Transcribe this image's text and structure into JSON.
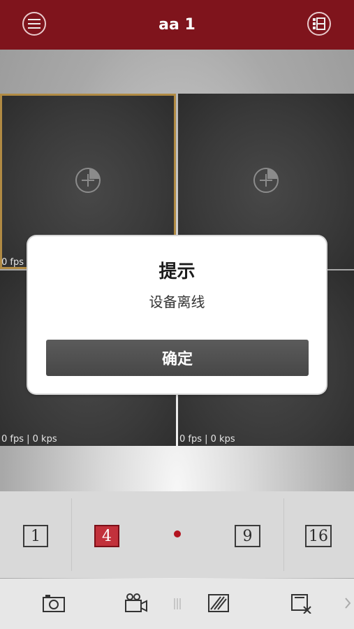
{
  "header": {
    "title": "aa 1",
    "menu_icon": "menu-icon",
    "layout_icon": "layout-list-icon"
  },
  "cells": [
    {
      "stat": "0 fps"
    },
    {
      "stat": ""
    },
    {
      "stat": "0 fps | 0 kps"
    },
    {
      "stat": "0 fps | 0 kps"
    }
  ],
  "dialog": {
    "title": "提示",
    "message": "设备离线",
    "confirm_label": "确定"
  },
  "layouts": [
    "1",
    "4",
    "9",
    "16"
  ],
  "active_layout": "4",
  "toolbar": [
    "camera-icon",
    "record-icon",
    "image-icon",
    "close-window-icon",
    "chevron-right-icon"
  ],
  "colors": {
    "header": "#7f141c",
    "accent": "#b31420",
    "selected_border": "#b08a43"
  }
}
